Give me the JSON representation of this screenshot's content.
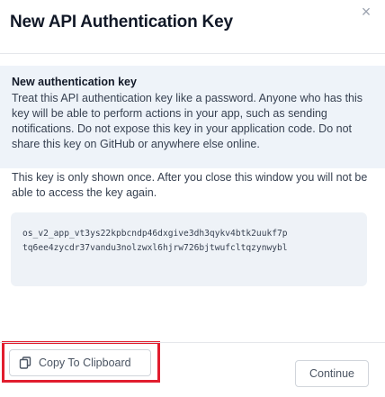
{
  "modal": {
    "title": "New API Authentication Key",
    "close_glyph": "×"
  },
  "alert": {
    "title": "New authentication key",
    "text": "Treat this API authentication key like a password. Anyone who has this key will be able to perform actions in your app, such as sending notifications. Do not expose this key in your application code. Do not share this key on GitHub or anywhere else online."
  },
  "notice": "This key is only shown once. After you close this window you will not be able to access the key again.",
  "api_key": {
    "line1": "os_v2_app_vt3ys22kpbcndp46dxgive3dh3qykv4btk2uukf7p",
    "line2": "tq6ee4zycdr37vandu3nolzwxl6hjrw726bjtwufcltqzynwybl"
  },
  "copy_button": {
    "label": "Copy To Clipboard",
    "icon": "clipboard-icon"
  },
  "footer": {
    "continue_label": "Continue"
  },
  "colors": {
    "highlight": "#e11d2e",
    "alert_bg": "#eef3f9"
  }
}
